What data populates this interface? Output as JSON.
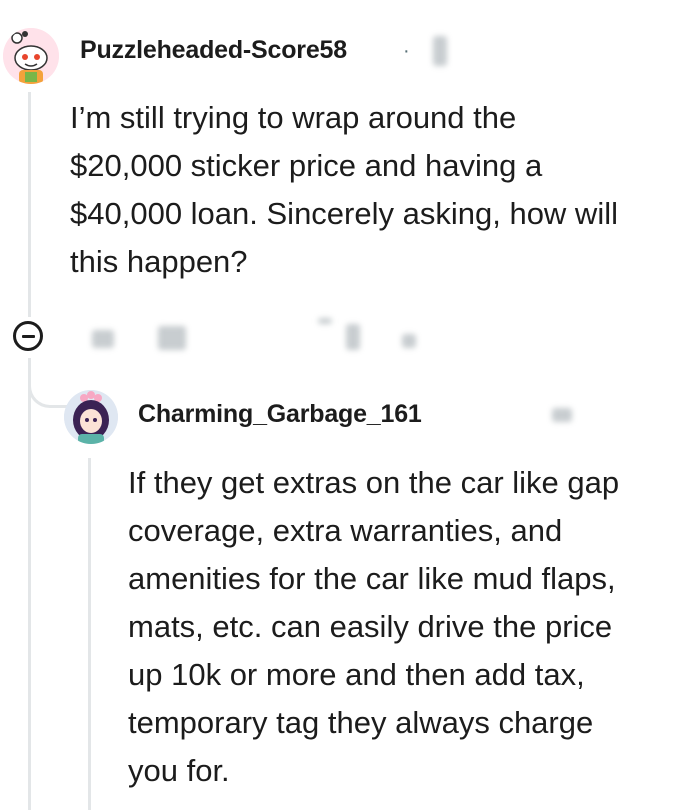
{
  "parent_comment": {
    "username": "Puzzleheaded-Score58",
    "separator": "·",
    "avatar_icon": "snoo-avatar-pink",
    "body": "I’m still trying to wrap around the\n$20,000 sticker price and having a\n$40,000 loan. Sincerely asking, how will\nthis happen?"
  },
  "actions": {
    "collapse_icon": "minus-circle-icon"
  },
  "reply_comment": {
    "username": "Charming_Garbage_161",
    "avatar_icon": "avatar-purple-hair",
    "body": "If they get extras on the car like gap\ncoverage, extra warranties, and\namenities for the car like mud flaps,\nmats, etc. can easily drive the price\nup 10k or more and then add tax,\ntemporary tag they always charge\nyou for."
  },
  "colors": {
    "text": "#1c1c1c",
    "thread_line": "#e3e6e8",
    "meta": "#576f76"
  }
}
